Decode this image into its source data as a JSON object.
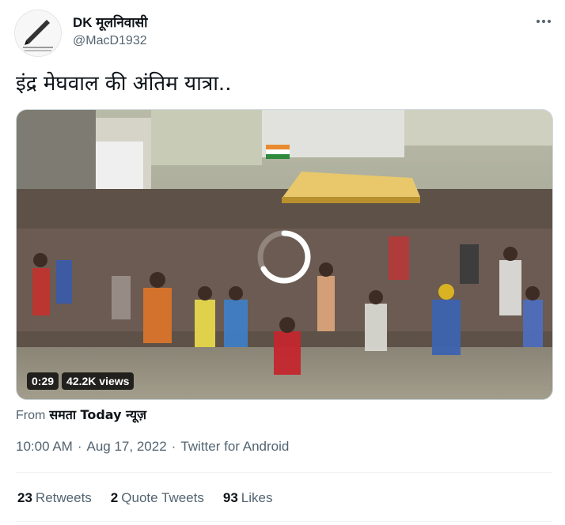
{
  "author": {
    "name": "DK मूलनिवासी",
    "handle": "@MacD1932"
  },
  "tweet": {
    "text": "इंद्र मेघवाल की अंतिम यात्रा.."
  },
  "video": {
    "duration": "0:29",
    "views": "42.2K views"
  },
  "source": {
    "prefix": "From",
    "name": "समता Today न्यूज़"
  },
  "meta": {
    "time": "10:00 AM",
    "separator": "·",
    "date": "Aug 17, 2022",
    "client": "Twitter for Android"
  },
  "stats": {
    "retweets_count": "23",
    "retweets_label": "Retweets",
    "quotes_count": "2",
    "quotes_label": "Quote Tweets",
    "likes_count": "93",
    "likes_label": "Likes"
  },
  "icons": {
    "more": "more-horizontal-icon",
    "loading": "loading-spinner-icon"
  },
  "colors": {
    "text_primary": "#0f1419",
    "text_secondary": "#536471",
    "divider": "#eff3f4"
  }
}
